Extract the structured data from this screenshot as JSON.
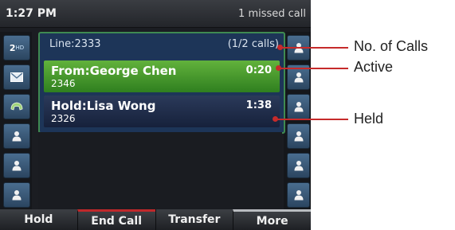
{
  "status_bar": {
    "time": "1:27 PM",
    "notification": "1 missed call"
  },
  "left_keys": [
    {
      "label": "2",
      "badge": "HD",
      "icon": "line-key-hd-icon"
    },
    {
      "icon": "envelope-icon"
    },
    {
      "icon": "handset-icon"
    },
    {
      "icon": "contact-icon"
    },
    {
      "icon": "contact-icon"
    },
    {
      "icon": "contact-icon"
    }
  ],
  "right_keys": [
    {
      "icon": "contact-icon"
    },
    {
      "icon": "contact-icon"
    },
    {
      "icon": "contact-icon"
    },
    {
      "icon": "contact-icon"
    },
    {
      "icon": "contact-icon"
    },
    {
      "icon": "contact-icon"
    }
  ],
  "main": {
    "line": "Line:2333",
    "calls_count": "(1/2 calls)",
    "active_call": {
      "name": "From:George Chen",
      "number": "2346",
      "timer": "0:20"
    },
    "held_call": {
      "name": "Hold:Lisa Wong",
      "number": "2326",
      "timer": "1:38"
    }
  },
  "softkeys": [
    "Hold",
    "End Call",
    "Transfer",
    "More"
  ],
  "callouts": {
    "calls": "No. of Calls",
    "active": "Active",
    "held": "Held"
  },
  "colors": {
    "active_call": "#4a9a2e",
    "held_call": "#1d2a48",
    "panel": "#1d3558",
    "callout": "#c62b2b"
  }
}
